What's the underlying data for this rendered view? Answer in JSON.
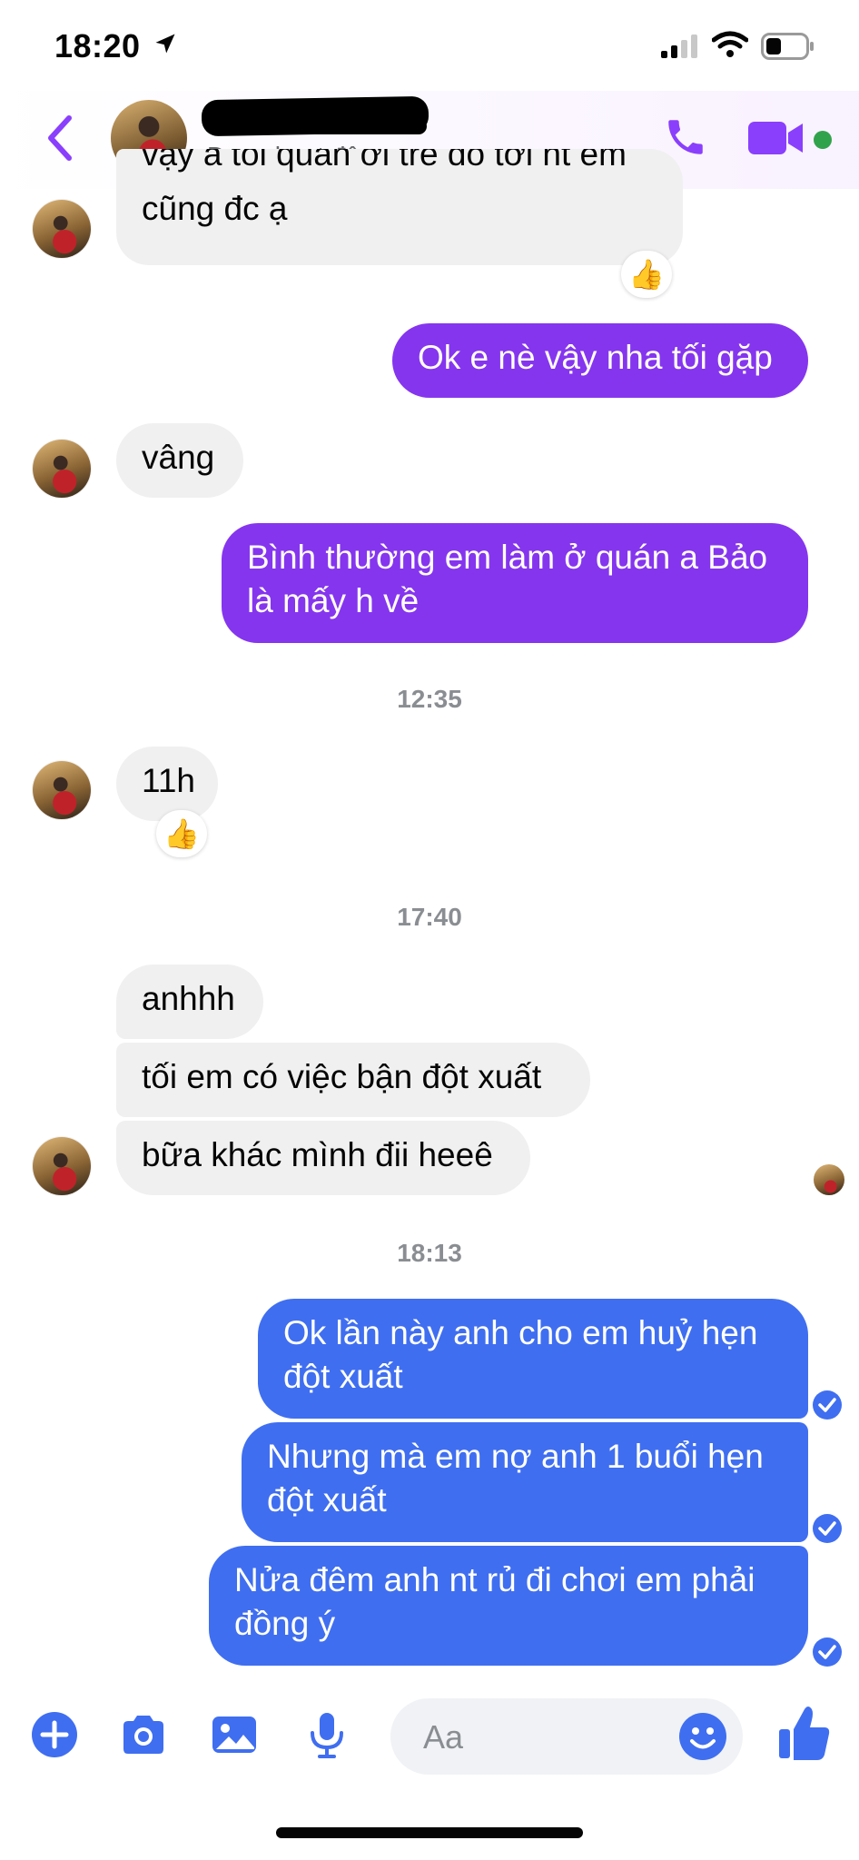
{
  "status_bar": {
    "time": "18:20"
  },
  "header": {
    "status": "Đang hoạt động"
  },
  "messages": [
    {
      "sender": "them",
      "text": "vậy a tối quán ơi tre đó tới nt em",
      "partial": true
    },
    {
      "sender": "them",
      "text": "cũng đc ạ",
      "reaction": "👍"
    },
    {
      "sender": "me",
      "text": "Ok e nè vậy nha tối gặp"
    },
    {
      "sender": "them",
      "text": "vâng"
    },
    {
      "sender": "me",
      "lines": [
        "Bình thường em làm ở quán a Bảo",
        "là mấy h về"
      ]
    },
    {
      "timestamp": "12:35"
    },
    {
      "sender": "them",
      "text": "11h",
      "reaction": "👍"
    },
    {
      "timestamp": "17:40"
    },
    {
      "sender": "them",
      "text": "anhhh"
    },
    {
      "sender": "them",
      "text": "tối em có việc bận đột xuất"
    },
    {
      "sender": "them",
      "text": "bữa khác mình đii heeê"
    },
    {
      "timestamp": "18:13"
    },
    {
      "sender": "me",
      "lines": [
        "Ok lần này anh cho em huỷ hẹn",
        "đột xuất"
      ]
    },
    {
      "sender": "me",
      "lines": [
        "Nhưng mà em nợ anh 1 buổi hẹn",
        "đột xuất"
      ]
    },
    {
      "sender": "me",
      "lines": [
        "Nửa đêm anh nt rủ đi chơi em phải",
        "đồng ý"
      ]
    }
  ],
  "composer": {
    "placeholder": "Aa"
  },
  "colors": {
    "purple_bubble": "#8535ee",
    "blue_bubble": "#3f6ef0",
    "incoming_bubble": "#f0f0f0",
    "accent": "#8a3ffc",
    "online": "#31a24c"
  },
  "icons": [
    "location-arrow-icon",
    "signal-icon",
    "wifi-icon",
    "battery-icon",
    "back-chevron-icon",
    "phone-icon",
    "video-camera-icon",
    "plus-circle-icon",
    "camera-icon",
    "gallery-icon",
    "microphone-icon",
    "emoji-icon",
    "thumbs-up-icon",
    "seen-check-icon"
  ]
}
